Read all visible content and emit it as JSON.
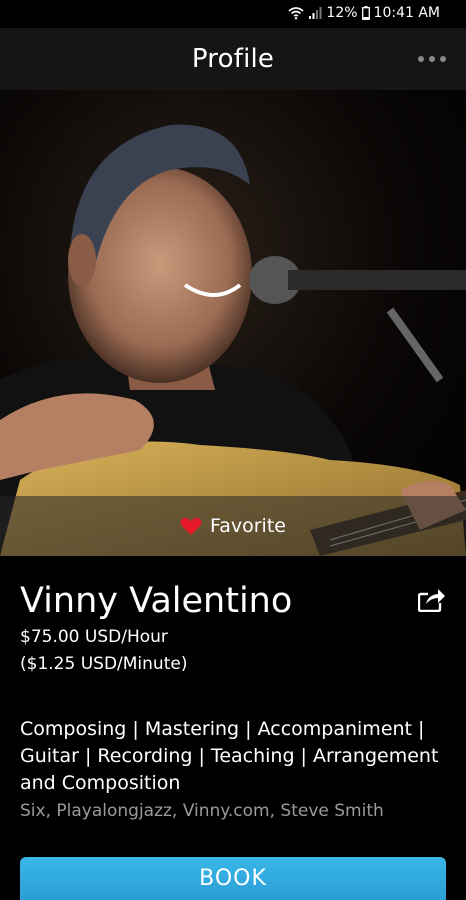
{
  "status": {
    "battery": "12%",
    "time": "10:41 AM"
  },
  "header": {
    "title": "Profile"
  },
  "profile": {
    "favorite_label": "Favorite",
    "name": "Vinny Valentino",
    "rate_hour": "$75.00 USD/Hour",
    "rate_minute": "($1.25 USD/Minute)",
    "skills": "Composing | Mastering | Accompaniment | Guitar | Recording | Teaching | Arrangement and Composition",
    "credits": "Six, Playalongjazz, Vinny.com, Steve Smith"
  },
  "actions": {
    "book_label": "BOOK"
  },
  "colors": {
    "accent": "#35b2e6",
    "favorite": "#e6192b",
    "header_bg": "#151515"
  }
}
